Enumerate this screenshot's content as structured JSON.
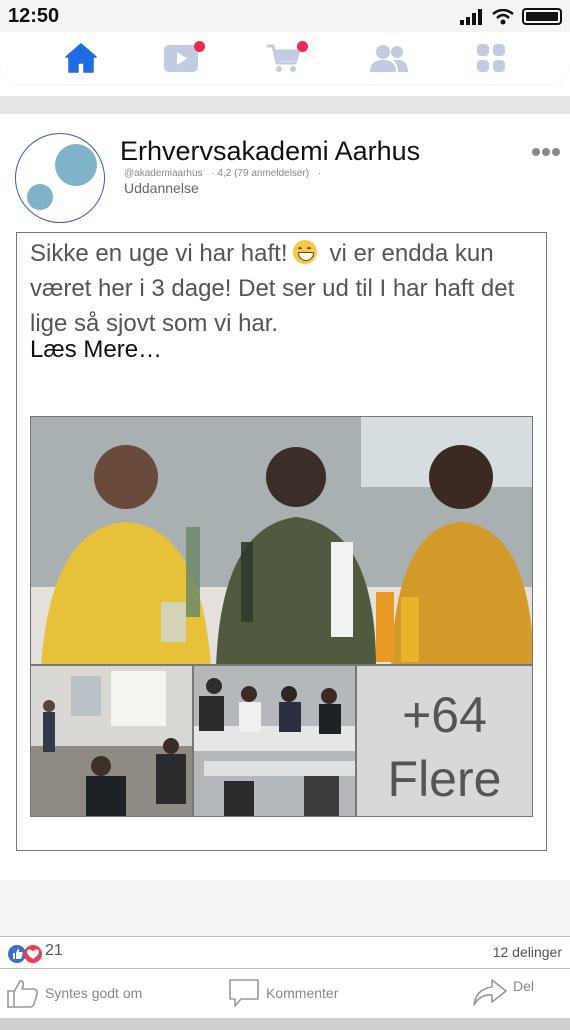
{
  "status_bar": {
    "time": "12:50"
  },
  "nav": {
    "items": [
      {
        "name": "home",
        "icon": "home-icon",
        "active": true,
        "badge": false
      },
      {
        "name": "watch",
        "icon": "video-icon",
        "active": false,
        "badge": true
      },
      {
        "name": "marketplace",
        "icon": "cart-icon",
        "active": false,
        "badge": true
      },
      {
        "name": "groups",
        "icon": "people-icon",
        "active": false,
        "badge": false
      },
      {
        "name": "menu",
        "icon": "grid-icon",
        "active": false,
        "badge": false
      }
    ],
    "active_color": "#1f6be6",
    "inactive_color": "#c3cbe0",
    "badge_color": "#ee2a4f"
  },
  "post": {
    "page_name": "Erhvervsakademi Aarhus",
    "handle": "@akademiaarhus",
    "rating": "· 4,2 (79 anmeldelser)",
    "meta_dot": "·",
    "category": "Uddannelse",
    "text_before_emoji": "Sikke en uge vi har haft!",
    "text_after_emoji": "vi er endda kun været her i 3 dage! Det ser ud til I har haft det lige så sjovt som vi har.",
    "read_more": "Læs Mere…",
    "more_photos_count": "+64",
    "more_photos_label": "Flere"
  },
  "engagement": {
    "reaction_count": "21",
    "shares": "12 delinger"
  },
  "actions": {
    "like": "Syntes godt om",
    "comment": "Kommenter",
    "share": "Del"
  }
}
